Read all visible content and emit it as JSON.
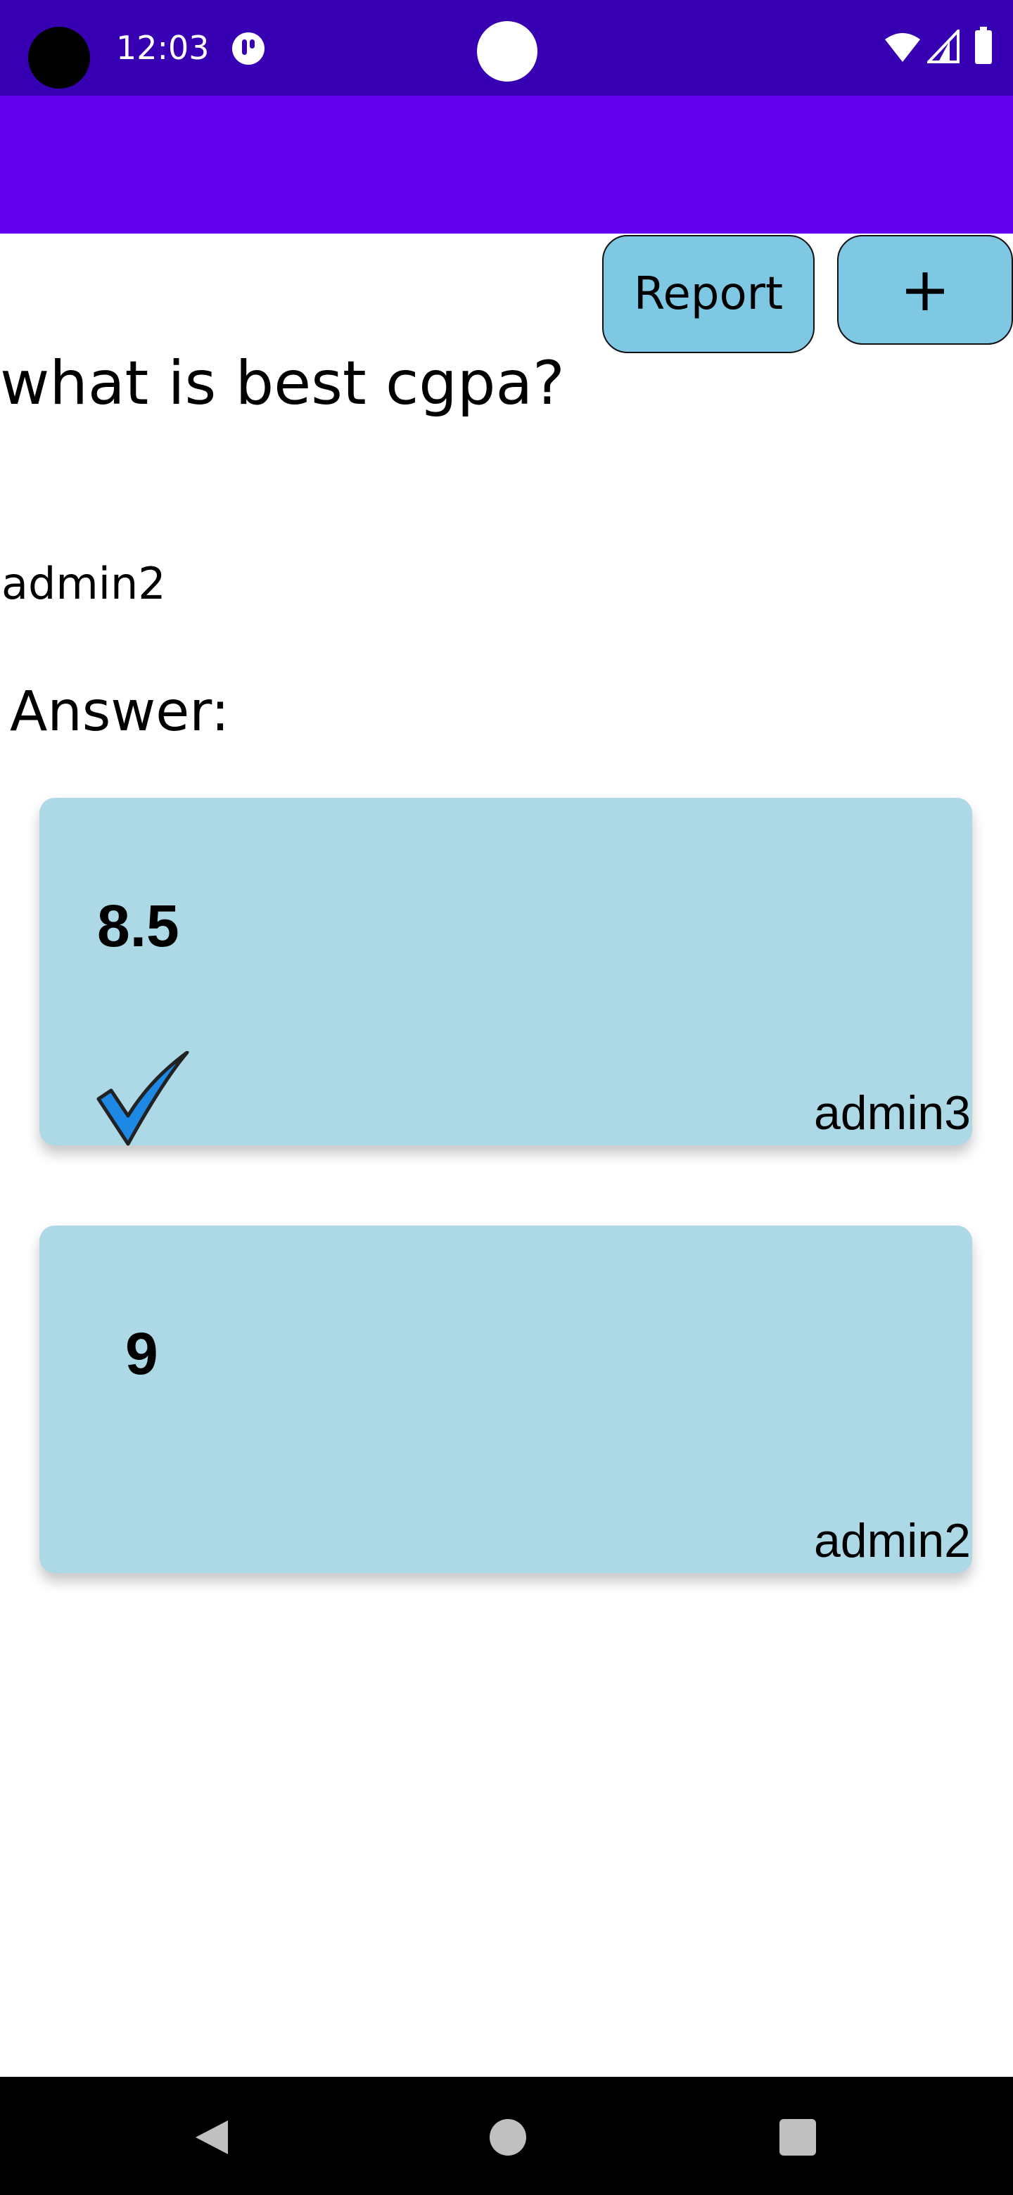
{
  "status_bar": {
    "time": "12:03",
    "icons": [
      "notification-icon",
      "wifi-icon",
      "cellular-signal-icon",
      "battery-icon"
    ],
    "background_color": "#3700b3"
  },
  "app_bar": {
    "background_color": "#6200ee"
  },
  "actions": {
    "report_label": "Report",
    "add_label": "+",
    "button_color": "#7ec8e3"
  },
  "question": {
    "title": "what is best cgpa?",
    "author": "admin2"
  },
  "answers_heading": "Answer:",
  "answers": [
    {
      "value": "8.5",
      "author": "admin3",
      "accepted": true
    },
    {
      "value": "9",
      "author": "admin2",
      "accepted": false
    }
  ],
  "card_color": "#add8e6",
  "accepted_icon_color": "#1e88e5",
  "nav_bar": {
    "buttons": [
      "back-icon",
      "home-icon",
      "recents-icon"
    ]
  }
}
